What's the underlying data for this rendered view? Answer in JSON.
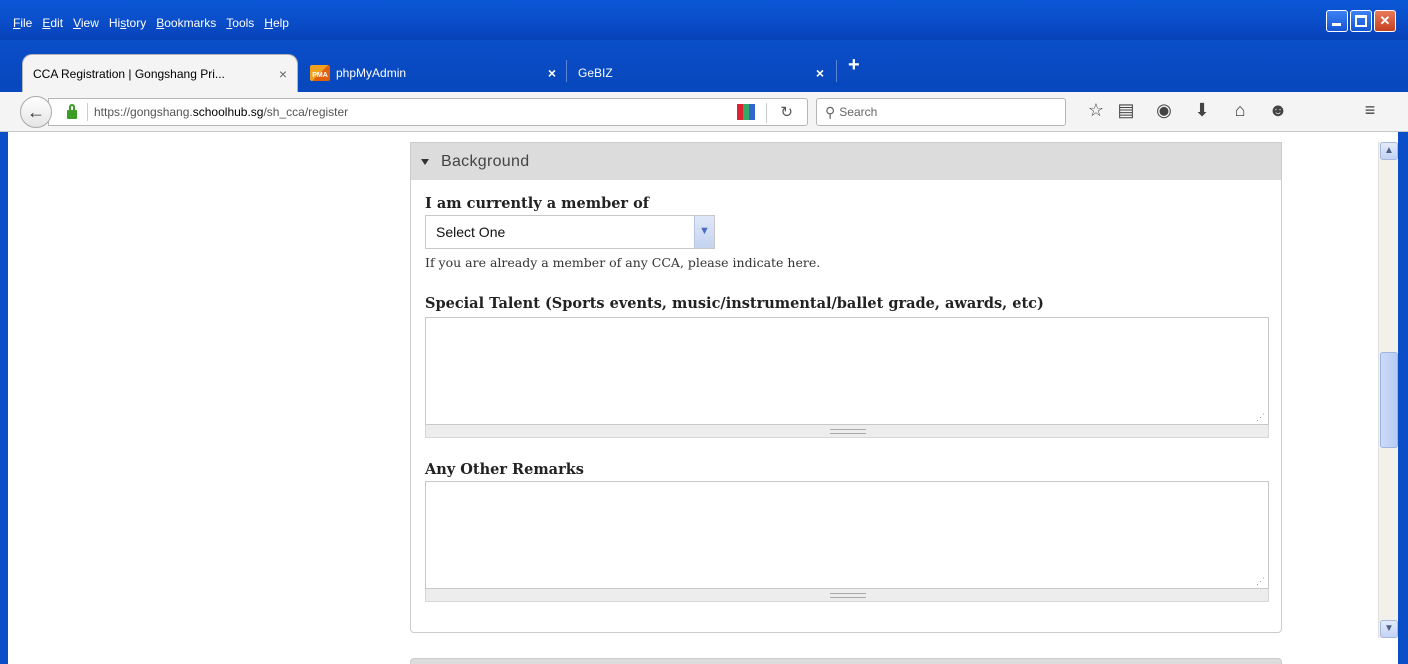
{
  "menu": [
    {
      "label": "File",
      "key": "F",
      "rest": "ile"
    },
    {
      "label": "Edit",
      "key": "E",
      "rest": "dit"
    },
    {
      "label": "View",
      "key": "V",
      "rest": "iew"
    },
    {
      "label": "History",
      "key": "s",
      "pre": "Hi",
      "rest": "tory"
    },
    {
      "label": "Bookmarks",
      "key": "B",
      "rest": "ookmarks"
    },
    {
      "label": "Tools",
      "key": "T",
      "rest": "ools"
    },
    {
      "label": "Help",
      "key": "H",
      "rest": "elp"
    }
  ],
  "tabs": {
    "active": {
      "title": "CCA Registration | Gongshang Pri...",
      "close": "×"
    },
    "second": {
      "title": "phpMyAdmin",
      "icon_text": "PMA",
      "close": "×"
    },
    "third": {
      "title": "GeBIZ",
      "close": "×"
    },
    "new_tab": "+"
  },
  "nav": {
    "url_prefix": "https://gongshang.",
    "url_domain": "schoolhub.sg",
    "url_path": "/sh_cca/register",
    "search_placeholder": "Search"
  },
  "form": {
    "legend": "Background",
    "member_label": "I am currently a member of",
    "member_select_value": "Select One",
    "member_help": "If you are already a member of any CCA, please indicate here.",
    "talent_label": "Special Talent (Sports events, music/instrumental/ballet grade, awards, etc)",
    "remarks_label": "Any Other Remarks"
  },
  "icons": {
    "back": "arrow-left-icon",
    "lock": "lock-icon",
    "reload": "reload-icon",
    "search": "search-icon",
    "toolbar": [
      "star-icon",
      "reading-list-icon",
      "pocket-icon",
      "download-icon",
      "home-icon",
      "chat-icon",
      "hamburger-menu-icon"
    ]
  },
  "colors": {
    "titlebar": "#0a4ec8",
    "legend_bg": "#dcdcdc",
    "lock_green": "#3a9c23"
  }
}
